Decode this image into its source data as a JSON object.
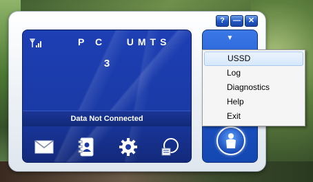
{
  "window": {
    "help_label": "?",
    "minimize_label": "—",
    "close_label": "✕"
  },
  "screen": {
    "network_label": "P C   UMTS",
    "network_number": "3",
    "status_text": "Data Not Connected"
  },
  "side_panel": {
    "dropdown_arrow": "▼"
  },
  "menu": {
    "items": [
      {
        "label": "USSD"
      },
      {
        "label": "Log"
      },
      {
        "label": "Diagnostics"
      },
      {
        "label": "Help"
      },
      {
        "label": "Exit"
      }
    ],
    "highlighted_index": 0
  },
  "icons": {
    "signal": "signal-strength-icon",
    "sms": "envelope-icon",
    "contacts": "phonebook-icon",
    "settings": "gear-icon",
    "stats": "connection-stats-icon",
    "connect": "person-icon"
  },
  "colors": {
    "screen_blue": "#1a3aa6",
    "accent_blue": "#1d56cc",
    "menu_bg": "#f5f5f5",
    "highlight": "#d7e8fb"
  }
}
